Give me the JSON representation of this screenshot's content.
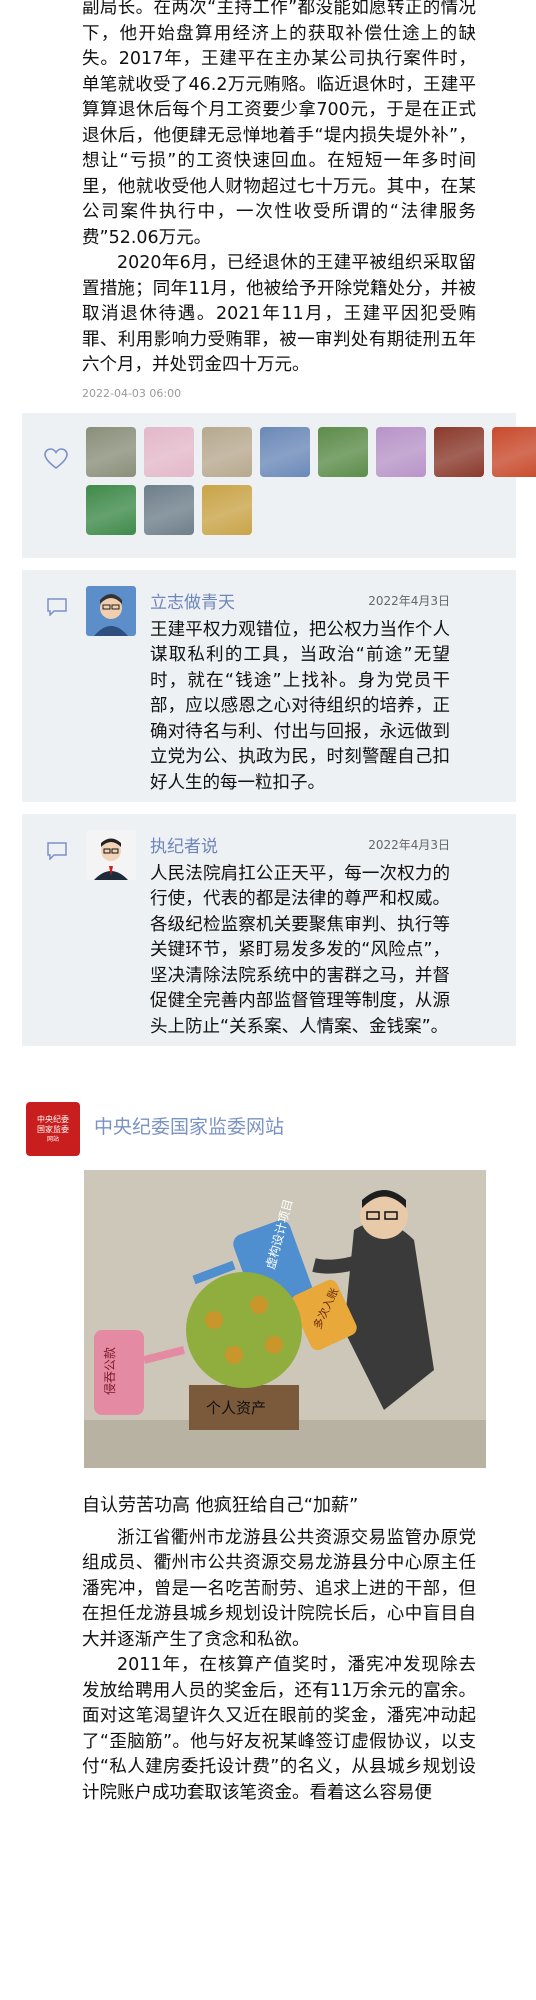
{
  "article": {
    "paragraphs_top": [
      "副局长。在两次“主持工作”都没能如愿转正的情况下，他开始盘算用经济上的获取补偿仕途上的缺失。2017年，王建平在主办某公司执行案件时，单笔就收受了46.2万元贿赂。临近退休时，王建平算算退休后每个月工资要少拿700元，于是在正式退休后，他便肆无忌惮地着手“堤内损失堤外补”，想让“亏损”的工资快速回血。在短短一年多时间里，他就收受他人财物超过七十万元。其中，在某公司案件执行中，一次性收受所谓的“法律服务费”52.06万元。",
      "2020年6月，已经退休的王建平被组织采取留置措施；同年11月，他被给予开除党籍处分，并被取消退休待遇。2021年11月，王建平因犯受贿罪、利用影响力受贿罪，被一审判处有期徒刑五年六个月，并处罚金四十万元。"
    ],
    "timestamp": "2022-04-03 06:00"
  },
  "likes": {
    "icon": "heart-icon",
    "avatars": [
      {
        "color": "#8a8f7a"
      },
      {
        "color": "#e3b8c9"
      },
      {
        "color": "#b7a98f"
      },
      {
        "color": "#6b89b8"
      },
      {
        "color": "#5c8c4a"
      },
      {
        "color": "#b894c8"
      },
      {
        "color": "#8a3a2c"
      },
      {
        "color": "#c84a2c"
      },
      {
        "color": "#3f8a4a"
      },
      {
        "color": "#6e7f8a"
      },
      {
        "color": "#c9a448"
      }
    ]
  },
  "comments": [
    {
      "name": "立志做青天",
      "date": "2022年4月3日",
      "text": "王建平权力观错位，把公权力当作个人谋取私利的工具，当政治“前途”无望时，就在“钱途”上找补。身为党员干部，应以感恩之心对待组织的培养，正确对待名与利、付出与回报，永远做到立党为公、执政为民，时刻警醒自己扣好人生的每一粒扣子。"
    },
    {
      "name": "执纪者说",
      "date": "2022年4月3日",
      "text": "人民法院肩扛公正天平，每一次权力的行使，代表的都是法律的尊严和权威。各级纪检监察机关要聚焦审判、执行等关键环节，紧盯易发多发的“风险点”，坚决清除法院系统中的害群之马，并督促健全完善内部监督管理等制度，从源头上防止“关系案、人情案、金钱案”。"
    }
  ],
  "source": {
    "logo_lines": [
      "中央纪委",
      "国家监委",
      "网站"
    ],
    "name": "中央纪委国家监委网站"
  },
  "cartoon": {
    "labels": [
      "虚构设计项目",
      "多次入账",
      "侵吞公款",
      "个人资产"
    ]
  },
  "section2": {
    "subhead": "自认劳苦功高 他疯狂给自己“加薪”",
    "paragraphs": [
      "浙江省衢州市龙游县公共资源交易监管办原党组成员、衢州市公共资源交易龙游县分中心原主任潘宪冲，曾是一名吃苦耐劳、追求上进的干部，但在担任龙游县城乡规划设计院院长后，心中盲目自大并逐渐产生了贪念和私欲。",
      "2011年，在核算产值奖时，潘宪冲发现除去发放给聘用人员的奖金后，还有11万余元的富余。面对这笔渴望许久又近在眼前的奖金，潘宪冲动起了“歪脑筋”。他与好友祝某峰签订虚假协议，以支付“私人建房委托设计费”的名义，从县城乡规划设计院账户成功套取该笔资金。看着这么容易便"
    ]
  }
}
